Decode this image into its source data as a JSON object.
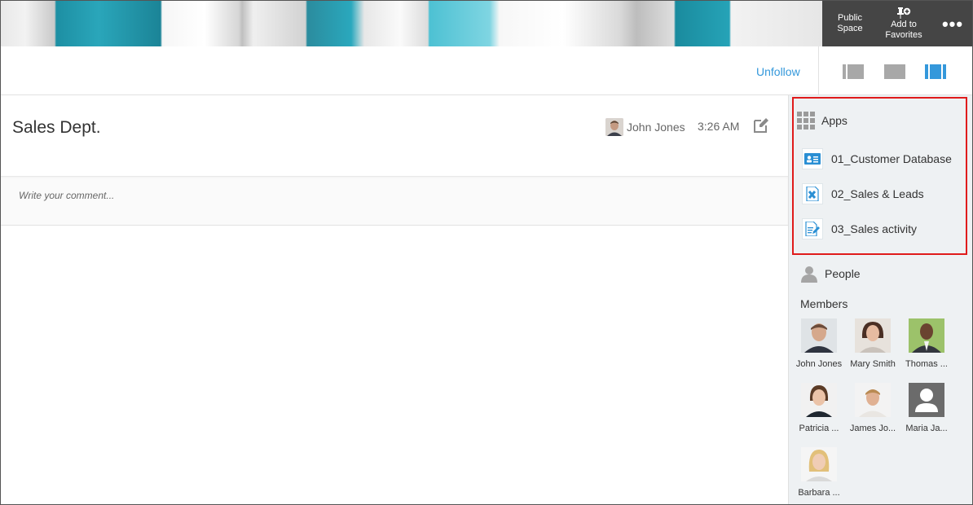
{
  "header": {
    "public_space": [
      "Public",
      "Space"
    ],
    "add_to_favorites": [
      "Add to",
      "Favorites"
    ],
    "more": "•••"
  },
  "toolbar": {
    "unfollow": "Unfollow",
    "accent": "#3498db"
  },
  "thread": {
    "title": "Sales Dept.",
    "author": "John Jones",
    "time": "3:26 AM",
    "comment_placeholder": "Write your comment..."
  },
  "sidebar": {
    "apps_title": "Apps",
    "apps": [
      {
        "label": "01_Customer Database",
        "icon": "customer-card-icon"
      },
      {
        "label": "02_Sales & Leads",
        "icon": "spreadsheet-icon"
      },
      {
        "label": "03_Sales activity",
        "icon": "document-edit-icon"
      }
    ],
    "people_title": "People",
    "members_label": "Members",
    "members": [
      {
        "name": "John Jones"
      },
      {
        "name": "Mary Smith"
      },
      {
        "name": "Thomas ..."
      },
      {
        "name": "Patricia ..."
      },
      {
        "name": "James Jo..."
      },
      {
        "name": "Maria Ja..."
      },
      {
        "name": "Barbara ..."
      }
    ],
    "highlight_color": "#e01b1b"
  }
}
